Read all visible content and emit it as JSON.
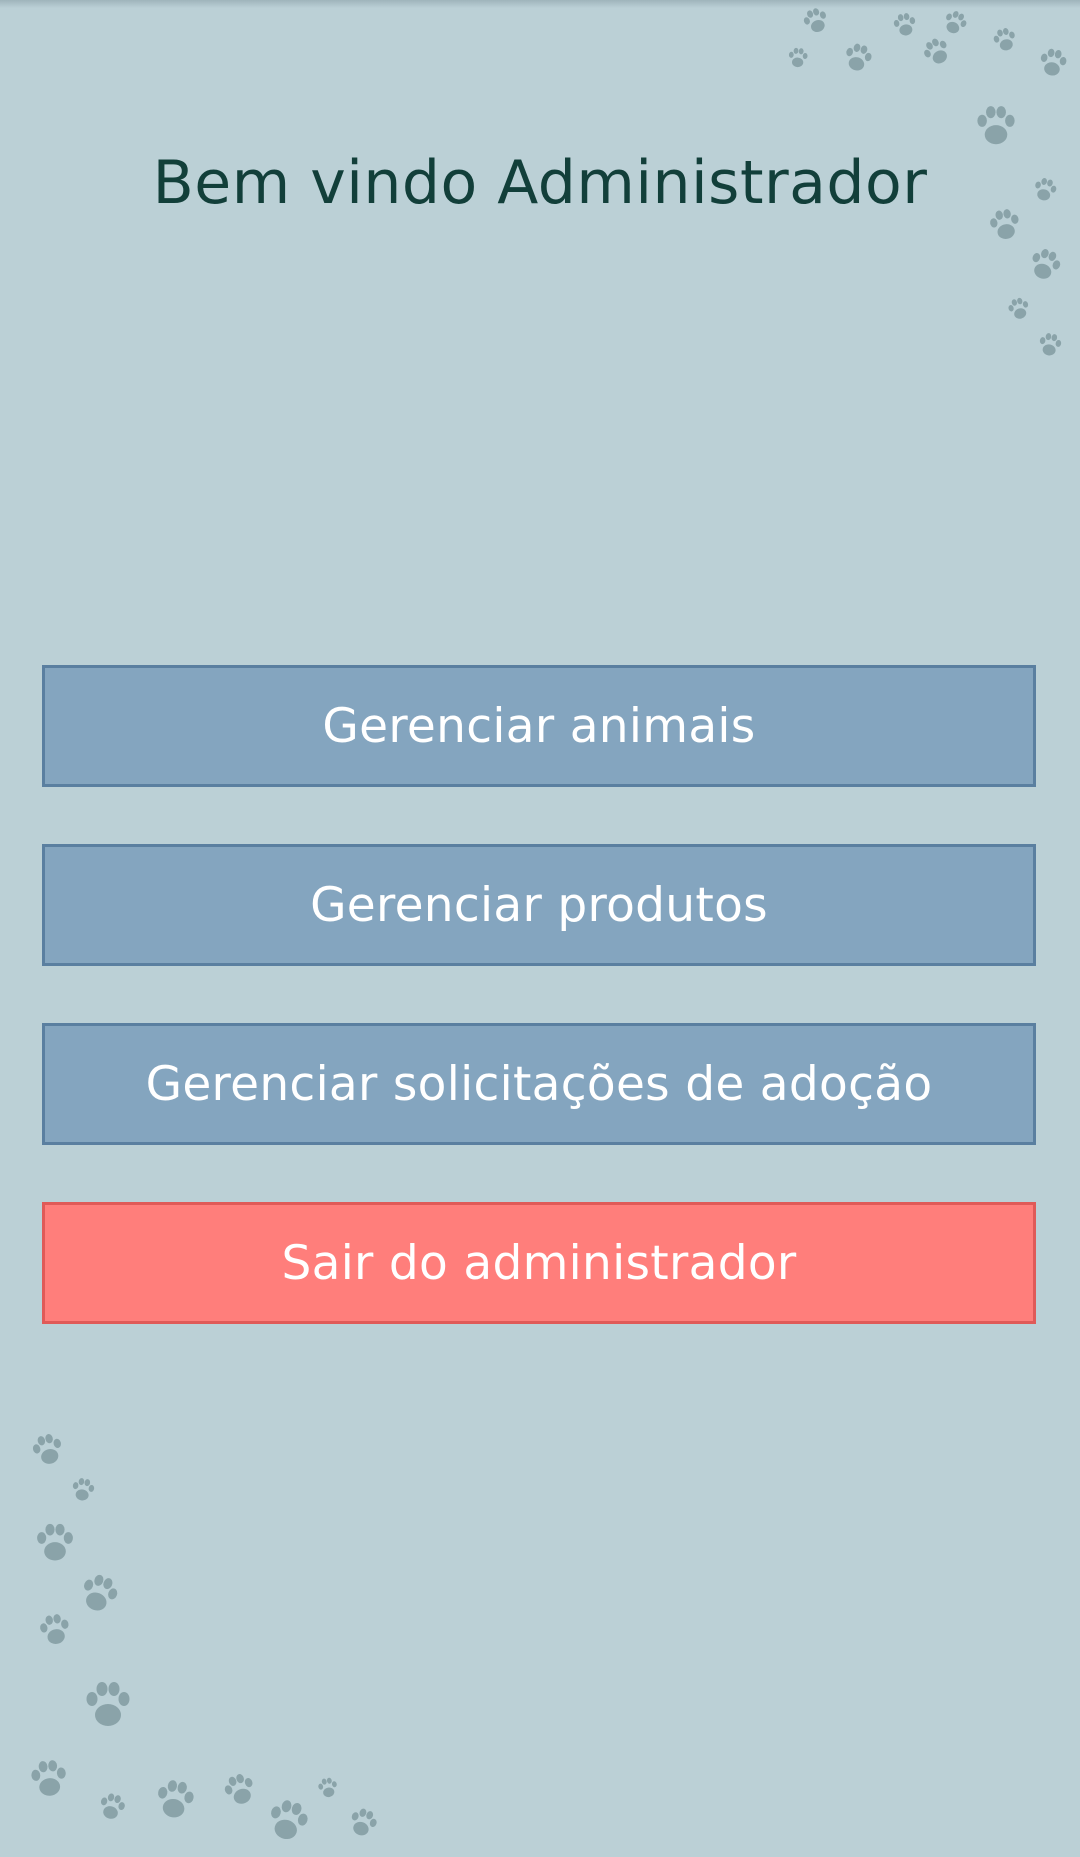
{
  "header": {
    "title": "Bem vindo Administrador"
  },
  "menu": {
    "buttons": [
      {
        "label": "Gerenciar animais"
      },
      {
        "label": "Gerenciar produtos"
      },
      {
        "label": "Gerenciar solicitações de adoção"
      },
      {
        "label": "Sair do administrador"
      }
    ]
  },
  "colors": {
    "background": "#bbd0d6",
    "title": "#123f3a",
    "primary_button": "#84a5bf",
    "danger_button": "#ff7e7b"
  },
  "icons": {
    "decoration": "paw-print-icon"
  }
}
